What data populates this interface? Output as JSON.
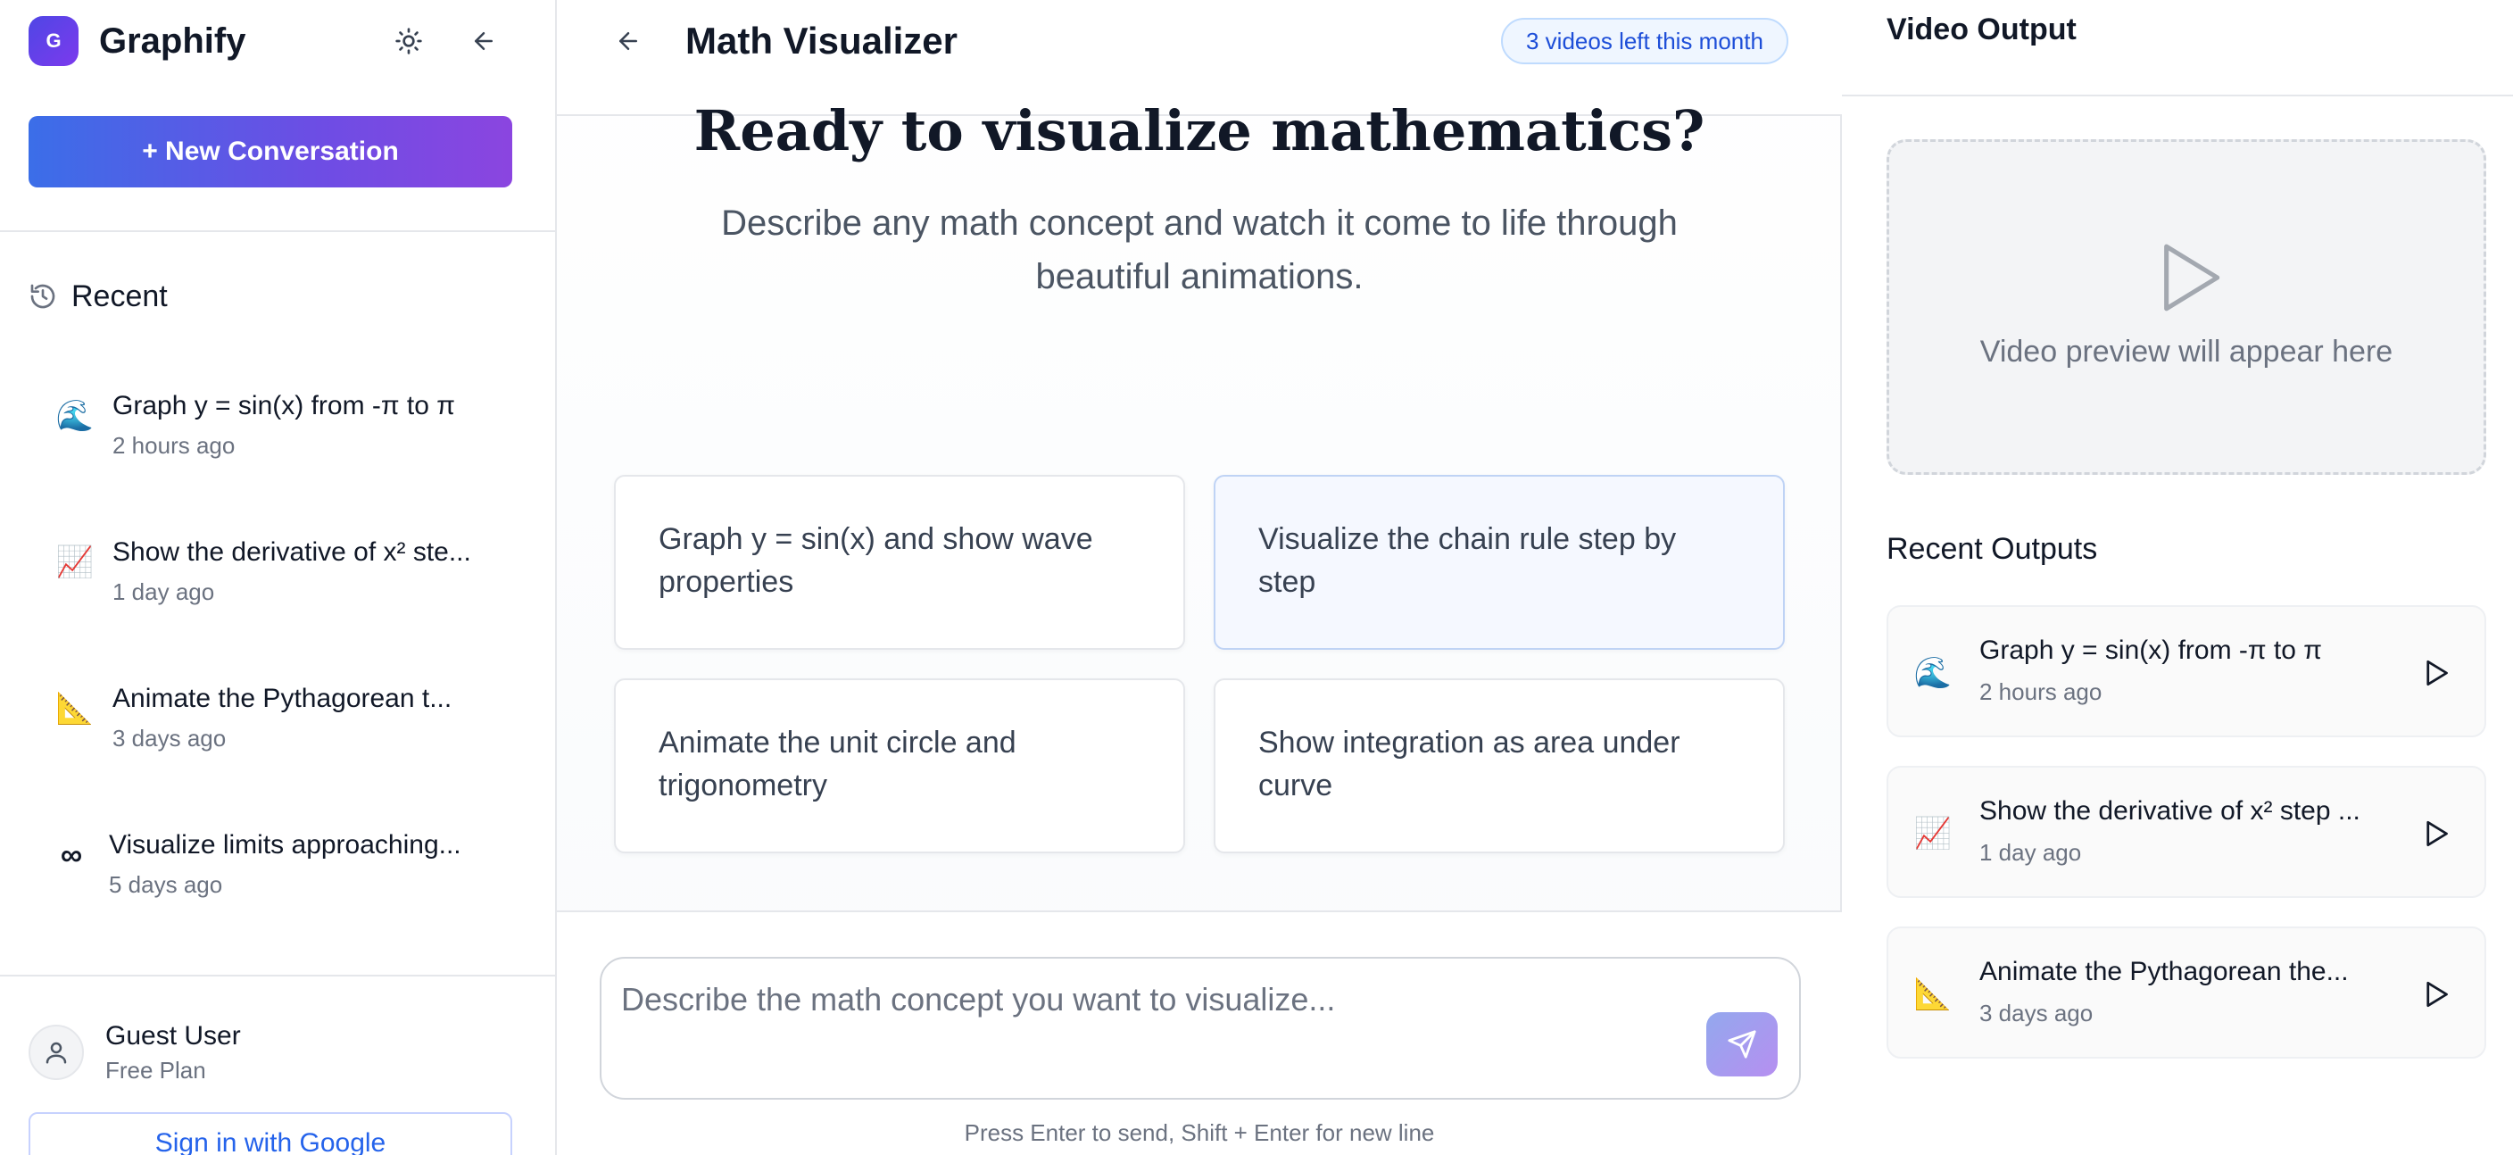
{
  "sidebar": {
    "brand": {
      "logo_letter": "G",
      "name": "Graphify"
    },
    "new_conversation_label": "+ New Conversation",
    "recent_label": "Recent",
    "conversations": [
      {
        "emoji": "🌊",
        "title": "Graph y = sin(x) from -π to π",
        "time": "2 hours ago"
      },
      {
        "emoji": "📈",
        "title": "Show the derivative of x² ste...",
        "time": "1 day ago"
      },
      {
        "emoji": "📐",
        "title": "Animate the Pythagorean t...",
        "time": "3 days ago"
      },
      {
        "emoji": "∞",
        "title": "Visualize limits approaching...",
        "time": "5 days ago"
      }
    ],
    "user": {
      "name": "Guest User",
      "plan": "Free Plan"
    },
    "sign_in_label": "Sign in with Google"
  },
  "main": {
    "title": "Math Visualizer",
    "quota_badge": "3 videos left this month",
    "hero_title": "Ready to visualize mathematics?",
    "hero_subtitle": "Describe any math concept and watch it come to life through beautiful animations.",
    "suggestions": [
      {
        "text": "Graph y = sin(x) and show wave properties"
      },
      {
        "text": "Visualize the chain rule step by step"
      },
      {
        "text": "Animate the unit circle and trigonometry"
      },
      {
        "text": "Show integration as area under curve"
      }
    ],
    "composer": {
      "placeholder": "Describe the math concept you want to visualize...",
      "value": ""
    },
    "hint": "Press Enter to send, Shift + Enter for new line"
  },
  "right_panel": {
    "title": "Video Output",
    "preview_text": "Video preview will appear here",
    "recent_outputs_label": "Recent Outputs",
    "outputs": [
      {
        "emoji": "🌊",
        "title": "Graph y = sin(x) from -π to π",
        "time": "2 hours ago"
      },
      {
        "emoji": "📈",
        "title": "Show the derivative of x² step ...",
        "time": "1 day ago"
      },
      {
        "emoji": "📐",
        "title": "Animate the Pythagorean the...",
        "time": "3 days ago"
      }
    ]
  },
  "colors": {
    "accent_gradient_start": "#3b6ee8",
    "accent_gradient_end": "#8b45e0",
    "badge_text": "#1d4ed8",
    "badge_bg": "#eff6ff",
    "sign_in_text": "#2563eb"
  }
}
